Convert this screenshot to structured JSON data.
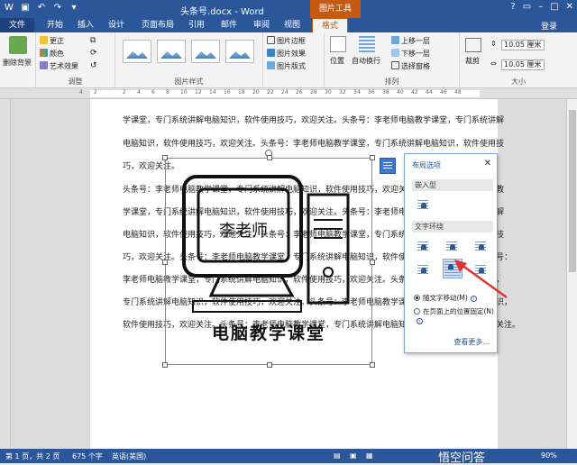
{
  "titlebar": {
    "doc_title": "头条号.docx - Word",
    "tools_label": "图片工具",
    "help": "?",
    "login": "登录"
  },
  "tabs": [
    "文件",
    "开始",
    "插入",
    "设计",
    "页面布局",
    "引用",
    "邮件",
    "审阅",
    "视图",
    "格式"
  ],
  "ribbon": {
    "remove_bg": "删除背景",
    "adjust": {
      "correct": "更正",
      "color": "颜色",
      "artistic": "艺术效果",
      "label": "调整"
    },
    "styles_label": "图片样式",
    "border": "图片边框",
    "effects": "图片效果",
    "layout": "图片版式",
    "arrange": {
      "position": "位置",
      "wrap": "自动换行",
      "forward": "上移一层",
      "backward": "下移一层",
      "pane": "选择窗格",
      "label": "排列"
    },
    "crop": "裁剪",
    "height": "10.05 厘米",
    "width": "10.05 厘米",
    "size_label": "大小"
  },
  "ruler_numbers": [
    "4",
    "2",
    "",
    "2",
    "4",
    "6",
    "8",
    "10",
    "12",
    "14",
    "16",
    "18",
    "20",
    "22",
    "24",
    "26",
    "28",
    "30",
    "32",
    "34",
    "36",
    "38",
    "40",
    "42",
    "44",
    "46",
    "48"
  ],
  "document": {
    "lines": [
      "学课堂，专门系统讲解电脑知识，软件使用技巧，欢迎关注。头条号：李老师电脑教学课堂，专门系统讲解",
      "电脑知识，软件使用技巧，欢迎关注。头条号：李老师电脑教学课堂，专门系统讲解电脑知识，软件使用技",
      "巧，欢迎关注。",
      "头条号：李老师电脑教学课堂，专门系统讲解电脑知识，软件使用技巧，欢迎关注。头条号：李老师电脑教",
      "学课堂，专门系统讲解电脑知识，软件使用技巧，欢迎关注。头条号：李老师电脑教学课堂，专门系统讲解",
      "电脑知识，软件使用技巧，欢迎关注。头条号：李老师电脑教学课堂，专门系统讲解电脑知识，软件使用技",
      "巧，欢迎关注。头条号：李老师电脑教学课堂，专门系统讲解电脑知识，软件使用技巧，欢迎关注。头条号：",
      "李老师电脑教学课堂，专门系统讲解电脑知识，软件使用技巧，欢迎关注。头条号：李老师电脑教学课堂，",
      "专门系统讲解电脑知识，软件使用技巧，欢迎关注。头条号：李老师电脑教学课堂，专门系统讲解电脑知识，",
      "软件使用技巧，欢迎关注。头条号：李老师电脑教学课堂，专门系统讲解电脑知识，软件使用技巧，欢迎关注。"
    ],
    "image_text_top": "李老师",
    "image_text_bottom": "电脑教学课堂"
  },
  "layout_popup": {
    "title": "布局选项",
    "inline_section": "嵌入型",
    "wrap_section": "文字环绕",
    "move_with_text": "随文字移动(M)",
    "fix_position": "在页面上的位置固定(N)",
    "see_more": "查看更多..."
  },
  "statusbar": {
    "page": "第 1 页，共 2 页",
    "words": "675 个字",
    "lang": "英语(美国)",
    "zoom": "90%",
    "watermark": "悟空问答"
  },
  "colors": {
    "accent": "#2b579a",
    "tools": "#c55a11",
    "arrow": "#e0342f"
  }
}
